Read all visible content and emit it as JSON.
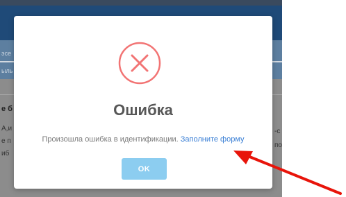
{
  "background": {
    "fragments": [
      {
        "text": "эсе"
      },
      {
        "text": "ыль"
      },
      {
        "text": "е б"
      },
      {
        "text": "А,и"
      },
      {
        "text": "е п"
      },
      {
        "text": "иб"
      },
      {
        "text": "-с"
      },
      {
        "text": "по"
      }
    ]
  },
  "modal": {
    "icon": "error-x-circle-icon",
    "title": "Ошибка",
    "message": "Произошла ошибка в идентификации.",
    "link_text": "Заполните форму",
    "ok_label": "OK"
  },
  "annotation": {
    "arrow_color": "#e8140a"
  },
  "colors": {
    "error": "#f27474",
    "ok_button": "#8ccdf0",
    "link": "#3a7fd5",
    "header": "#1f4a78"
  }
}
